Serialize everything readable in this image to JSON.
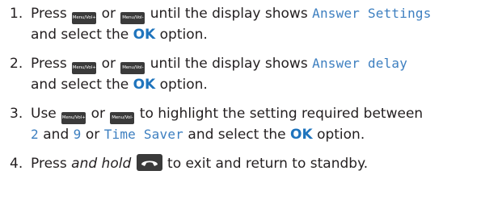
{
  "steps": [
    {
      "number": "1.",
      "text_press": "Press",
      "key_up": "Menu/Vol+",
      "text_or": "or",
      "key_down": "Menu/Vol-",
      "text_until": "until the display shows",
      "display_text": "Answer Settings",
      "text_select": "and select the",
      "ok": "OK",
      "text_option": "option."
    },
    {
      "number": "2.",
      "text_press": "Press",
      "key_up": "Menu/Vol+",
      "text_or": "or",
      "key_down": "Menu/Vol-",
      "text_until": "until the display shows",
      "display_text": "Answer delay",
      "text_select": "and select the",
      "ok": "OK",
      "text_option": "option."
    },
    {
      "number": "3.",
      "text_use": "Use",
      "key_up": "Menu/Vol+",
      "text_or": "or",
      "key_down": "Menu/Vol-",
      "text_highlight": "to highlight the setting required between",
      "value_min": "2",
      "text_and": "and",
      "value_max": "9",
      "text_or2": "or",
      "value_alt": "Time Saver",
      "text_select": "and select the",
      "ok": "OK",
      "text_option": "option."
    },
    {
      "number": "4.",
      "text_press": "Press",
      "text_hold": "and hold",
      "key_icon": "hang-up-phone-icon",
      "text_exit": "to exit and return to standby."
    }
  ],
  "colors": {
    "text": "#231f20",
    "display_text": "#3d7fc0",
    "ok_accent": "#1f74bd",
    "key_background": "#3a3a3a"
  }
}
